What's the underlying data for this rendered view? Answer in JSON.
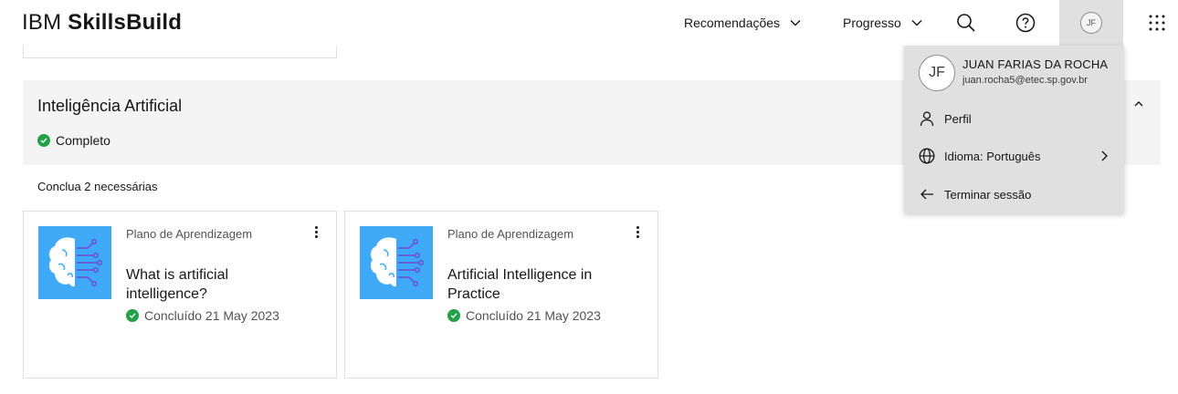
{
  "header": {
    "brand": "IBM",
    "product": "SkillsBuild",
    "nav": [
      {
        "label": "Recomendações"
      },
      {
        "label": "Progresso"
      }
    ],
    "avatar_initials": "JF"
  },
  "section": {
    "title": "Inteligência Artificial",
    "status": "Completo",
    "required_text": "Conclua 2 necessárias"
  },
  "cards": [
    {
      "type": "Plano de Aprendizagem",
      "title": "What is artificial intelligence?",
      "status": "Concluído 21 May 2023"
    },
    {
      "type": "Plano de Aprendizagem",
      "title": "Artificial Intelligence in Practice",
      "status": "Concluído 21 May 2023"
    }
  ],
  "user_menu": {
    "initials": "JF",
    "name": "JUAN FARIAS DA ROCHA",
    "email": "juan.rocha5@etec.sp.gov.br",
    "items": [
      {
        "label": "Perfil",
        "icon": "user-icon"
      },
      {
        "label": "Idioma: Português",
        "icon": "globe-icon"
      },
      {
        "label": "Terminar sessão",
        "icon": "arrow-left-icon"
      }
    ]
  },
  "colors": {
    "accent_green": "#24a148",
    "thumb_blue": "#3fa9f5",
    "section_bg": "#f4f4f4",
    "menu_bg": "#e0e0e0"
  }
}
